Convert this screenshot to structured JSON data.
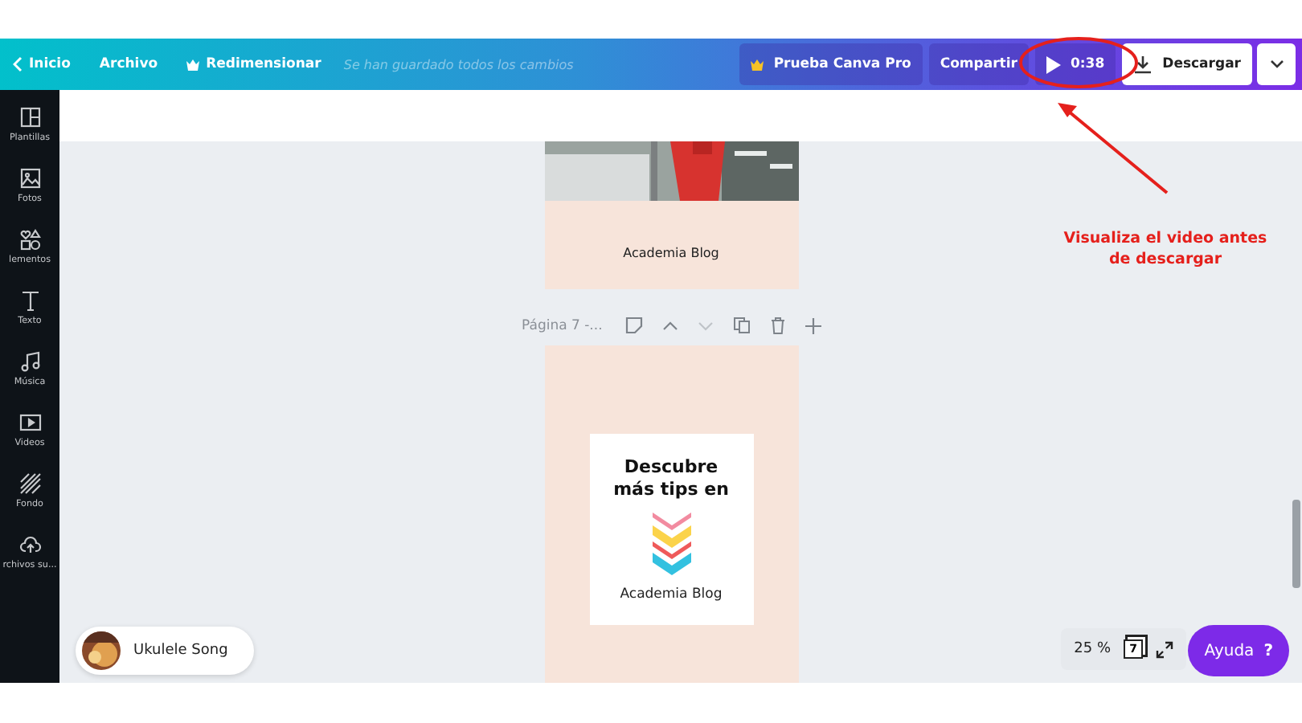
{
  "toolbar": {
    "nav": [
      {
        "label": "Inicio",
        "kind": "back"
      },
      {
        "label": "Archivo",
        "kind": "plain"
      },
      {
        "label": "Redimensionar",
        "kind": "crown"
      }
    ],
    "save_status": "Se han guardado todos los cambios",
    "actions": [
      {
        "label": "Prueba Canva Pro",
        "kind": "pro"
      },
      {
        "label": "Compartir",
        "kind": "share"
      },
      {
        "label": "0:38",
        "kind": "play"
      },
      {
        "label": "Descargar",
        "kind": "download"
      }
    ]
  },
  "sidebar": {
    "items": [
      {
        "label": "Plantillas",
        "kind": "templates"
      },
      {
        "label": "Fotos",
        "kind": "photos"
      },
      {
        "label": "lementos",
        "kind": "elements"
      },
      {
        "label": "Texto",
        "kind": "text"
      },
      {
        "label": "Música",
        "kind": "music"
      },
      {
        "label": "Videos",
        "kind": "videos"
      },
      {
        "label": "Fondo",
        "kind": "background"
      },
      {
        "label": "rchivos su...",
        "kind": "uploads"
      }
    ]
  },
  "pages": [
    {
      "caption": "Academia Blog"
    },
    {
      "kind": "promo",
      "label": "Página 7 -...",
      "heading": "Descubre más tips en",
      "caption": "Academia Blog"
    }
  ],
  "audio": {
    "title": "Ukulele Song"
  },
  "zoom": {
    "value": "25 %",
    "page_count": "7"
  },
  "help": {
    "label": "Ayuda",
    "mark": "?"
  },
  "annotation": {
    "text": "Visualiza el video antes de descargar"
  }
}
